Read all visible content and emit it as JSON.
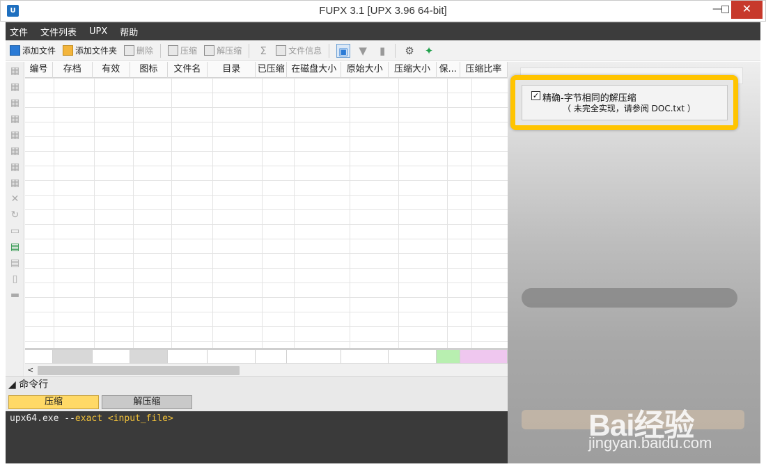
{
  "window": {
    "title": "FUPX 3.1   [UPX 3.96 64-bit]",
    "logo": "U",
    "minimize": "—",
    "maximize": "□",
    "close": "✕"
  },
  "menu": [
    "文件",
    "文件列表",
    "UPX",
    "帮助"
  ],
  "toolbar": {
    "add_file": "添加文件",
    "add_folder": "添加文件夹",
    "delete": "删除",
    "compress": "压缩",
    "decompress": "解压缩",
    "file_info": "文件信息"
  },
  "grid": {
    "columns": [
      "编号",
      "存档",
      "有效",
      "图标",
      "文件名",
      "目录",
      "已压缩",
      "在磁盘大小",
      "原始大小",
      "压缩大小",
      "保...",
      "压缩比率"
    ],
    "footer_colors": [
      "#ffffff",
      "#d8d8d8",
      "#ffffff",
      "#d8d8d8",
      "#ffffff",
      "#ffffff",
      "#ffffff",
      "#ffffff",
      "#ffffff",
      "#ffffff",
      "#b8efb0",
      "#efc7ef"
    ]
  },
  "scroll": {
    "left_arrow": "<"
  },
  "command": {
    "header": "命令行",
    "tab_compress": "压缩",
    "tab_decompress": "解压缩",
    "line_prefix": "upx64.exe --",
    "line_flag": "exact",
    "line_arg": "<input_file>"
  },
  "option": {
    "checked": true,
    "label": "精确-字节相同的解压缩",
    "note": "（ 未完全实现，请参阅 DOC.txt ）"
  },
  "watermark": {
    "brand": "Bai经验",
    "url": "jingyan.baidu.com"
  }
}
